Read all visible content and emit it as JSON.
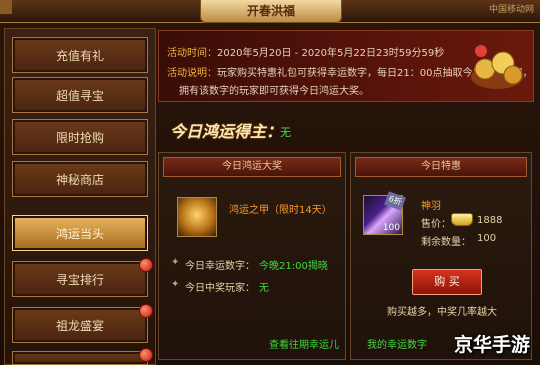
{
  "window": {
    "title": "开春洪福",
    "corner_text": "中国移动网"
  },
  "sidebar": {
    "items": [
      {
        "label": "充值有礼",
        "active": false,
        "badge": false
      },
      {
        "label": "超值寻宝",
        "active": false,
        "badge": false
      },
      {
        "label": "限时抢购",
        "active": false,
        "badge": false
      },
      {
        "label": "神秘商店",
        "active": false,
        "badge": false
      },
      {
        "label": "鸿运当头",
        "active": true,
        "badge": false
      },
      {
        "label": "寻宝排行",
        "active": false,
        "badge": true
      },
      {
        "label": "祖龙盛宴",
        "active": false,
        "badge": true
      },
      {
        "label": "",
        "active": false,
        "badge": true
      }
    ]
  },
  "info": {
    "time_label": "活动时间：",
    "time_value": "2020年5月20日 - 2020年5月22日23时59分59秒",
    "desc_label": "活动说明：",
    "desc_line1": "玩家购买特惠礼包可获得幸运数字，每日21：00点抽取今日幸运数字，",
    "desc_line2": "拥有该数字的玩家即可获得今日鸿运大奖。"
  },
  "lucky": {
    "title": "今日鸿运得主：",
    "value": "无"
  },
  "prize_panel": {
    "header": "今日鸿运大奖",
    "item_name": "鸿运之甲（限时14天）",
    "row1_label": "今日幸运数字：",
    "row1_value": "今晚21:00揭晓",
    "row2_label": "今日中奖玩家：",
    "row2_value": "无",
    "link": "查看往期幸运儿"
  },
  "deal_panel": {
    "header": "今日特惠",
    "item_name": "神羽",
    "item_count": "100",
    "item_tag": "6折",
    "price_label": "售价：",
    "price_value": "1888",
    "stock_label": "剩余数量：",
    "stock_value": "100",
    "buy_label": "购 买",
    "hint": "购买越多，中奖几率越大",
    "link": "我的幸运数字"
  },
  "watermark": "京华手游"
}
